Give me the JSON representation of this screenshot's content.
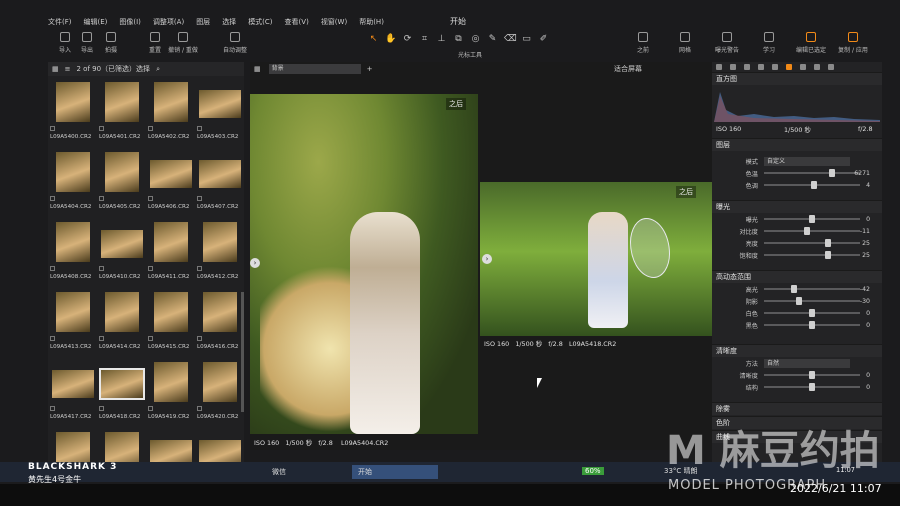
{
  "menu": [
    "文件(F)",
    "编辑(E)",
    "图像(I)",
    "调整项(A)",
    "图层",
    "选择",
    "模式(C)",
    "查看(V)",
    "视窗(W)",
    "帮助(H)"
  ],
  "app_title": "开始",
  "toolbar": {
    "left_tools": [
      {
        "label": "导入",
        "icon": "import-icon"
      },
      {
        "label": "导出",
        "icon": "export-icon"
      },
      {
        "label": "拍摄",
        "icon": "camera-icon"
      },
      {
        "label": "重置",
        "icon": "reset-icon"
      },
      {
        "label": "撤销 / 重做",
        "icon": "undo-redo-icon"
      },
      {
        "label": "自动调整",
        "icon": "wand-icon"
      }
    ],
    "cursor_tools_label": "光标工具",
    "cursor_tools": [
      "cursor-arrow-icon",
      "hand-icon",
      "rotate-icon",
      "crop-icon",
      "straighten-icon",
      "keystone-icon",
      "spot-icon",
      "brush-icon",
      "eraser-icon",
      "gradient-icon",
      "picker-icon"
    ],
    "right_tools": [
      {
        "label": "之前",
        "icon": "before-icon"
      },
      {
        "label": "网格",
        "icon": "grid-icon"
      },
      {
        "label": "曝光警告",
        "icon": "exposure-warning-icon"
      },
      {
        "label": "学习",
        "icon": "learn-icon"
      },
      {
        "label": "编辑已选定",
        "icon": "edit-selected-icon"
      },
      {
        "label": "复制 / 应用",
        "icon": "copy-apply-icon"
      }
    ]
  },
  "browser": {
    "count": "2 of 90（已筛选）选择",
    "thumbs": [
      {
        "file": "L09A5400.CR2",
        "wide": false
      },
      {
        "file": "L09A5401.CR2",
        "wide": false
      },
      {
        "file": "L09A5402.CR2",
        "wide": false
      },
      {
        "file": "L09A5403.CR2",
        "wide": true
      },
      {
        "file": "L09A5404.CR2",
        "wide": false
      },
      {
        "file": "L09A5405.CR2",
        "wide": false
      },
      {
        "file": "L09A5406.CR2",
        "wide": true
      },
      {
        "file": "L09A5407.CR2",
        "wide": true
      },
      {
        "file": "L09A5408.CR2",
        "wide": false
      },
      {
        "file": "L09A5410.CR2",
        "wide": true
      },
      {
        "file": "L09A5411.CR2",
        "wide": false
      },
      {
        "file": "L09A5412.CR2",
        "wide": false
      },
      {
        "file": "L09A5413.CR2",
        "wide": false
      },
      {
        "file": "L09A5414.CR2",
        "wide": false
      },
      {
        "file": "L09A5415.CR2",
        "wide": false
      },
      {
        "file": "L09A5416.CR2",
        "wide": false
      },
      {
        "file": "L09A5417.CR2",
        "wide": true
      },
      {
        "file": "L09A5418.CR2",
        "wide": true,
        "selected": true
      },
      {
        "file": "L09A5419.CR2",
        "wide": false
      },
      {
        "file": "L09A5420.CR2",
        "wide": false
      },
      {
        "file": "",
        "wide": false
      },
      {
        "file": "",
        "wide": false
      },
      {
        "file": "",
        "wide": true
      },
      {
        "file": "",
        "wide": true
      }
    ]
  },
  "viewer": {
    "background_select": "背景",
    "fit_label": "适合屏幕",
    "main": {
      "badge": "之后",
      "iso": "ISO 160",
      "shutter": "1/500 秒",
      "aperture": "f/2.8",
      "file": "L09A5404.CR2"
    },
    "second": {
      "badge": "之后",
      "iso": "ISO 160",
      "shutter": "1/500 秒",
      "aperture": "f/2.8",
      "file": "L09A5418.CR2"
    }
  },
  "tools": {
    "histogram": {
      "title": "直方图",
      "iso": "ISO 160",
      "shutter": "1/500 秒",
      "aperture": "f/2.8"
    },
    "layers": {
      "title": "图层"
    },
    "white_balance": {
      "mode_label": "模式",
      "mode_value": "自定义",
      "rows": [
        {
          "label": "色温",
          "value": "6271",
          "pos": 0.72
        },
        {
          "label": "色调",
          "value": "4",
          "pos": 0.52
        }
      ]
    },
    "exposure": {
      "title": "曝光",
      "rows": [
        {
          "label": "曝光",
          "value": "0",
          "pos": 0.5
        },
        {
          "label": "对比度",
          "value": "-11",
          "pos": 0.44
        },
        {
          "label": "亮度",
          "value": "25",
          "pos": 0.68
        },
        {
          "label": "饱和度",
          "value": "25",
          "pos": 0.68
        }
      ]
    },
    "hdr": {
      "title": "高动态范围",
      "rows": [
        {
          "label": "高光",
          "value": "-42",
          "pos": 0.3
        },
        {
          "label": "阴影",
          "value": "-30",
          "pos": 0.36
        },
        {
          "label": "白色",
          "value": "0",
          "pos": 0.5
        },
        {
          "label": "黑色",
          "value": "0",
          "pos": 0.5
        }
      ]
    },
    "clarity": {
      "title": "清晰度",
      "method_label": "方法",
      "method_value": "自然",
      "rows": [
        {
          "label": "清晰度",
          "value": "0",
          "pos": 0.5
        },
        {
          "label": "结构",
          "value": "0",
          "pos": 0.5
        }
      ]
    },
    "dehaze": {
      "title": "除雾"
    },
    "levels": {
      "title": "色阶"
    },
    "curve": {
      "title": "曲线"
    }
  },
  "taskbar": {
    "items": [
      "微信",
      "开始"
    ],
    "battery": "60%",
    "temperature": "33°C 晴朗",
    "time": "11:07",
    "date": "2022/6/21"
  },
  "overlays": {
    "phone_brand": "BLACKSHARK 3",
    "phone_sub": "黄先生4号金牛",
    "watermark": "M 麻豆约拍",
    "watermark_sub": "MODEL PHOTOGRAPH",
    "stamp": "2022/6/21 11:07"
  },
  "colors": {
    "accent": "#f28a18",
    "panel": "#232325",
    "taskbar": "#1f2633"
  }
}
